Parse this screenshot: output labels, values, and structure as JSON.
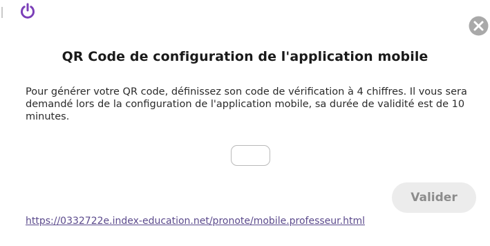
{
  "header": {
    "icons": {
      "power": "power-icon",
      "close": "close-icon"
    },
    "colors": {
      "power": "#7b3fb8",
      "close_bg": "#a9a9a9"
    }
  },
  "dialog": {
    "title": "QR Code de configuration de l'application mobile",
    "description": "Pour générer votre QR code, définissez son code de vérification à 4 chiffres. Il vous sera demandé lors de la configuration de l'application mobile, sa durée de validité est de 10 minutes.",
    "code_input": {
      "value": "",
      "placeholder": ""
    },
    "validate_label": "Valider",
    "link_text": "https://0332722e.index-education.net/pronote/mobile.professeur.html"
  },
  "colors": {
    "link": "#5b4a8c",
    "button_bg": "#ececec",
    "button_text": "#8c8c8c",
    "title": "#1a1a1a"
  }
}
